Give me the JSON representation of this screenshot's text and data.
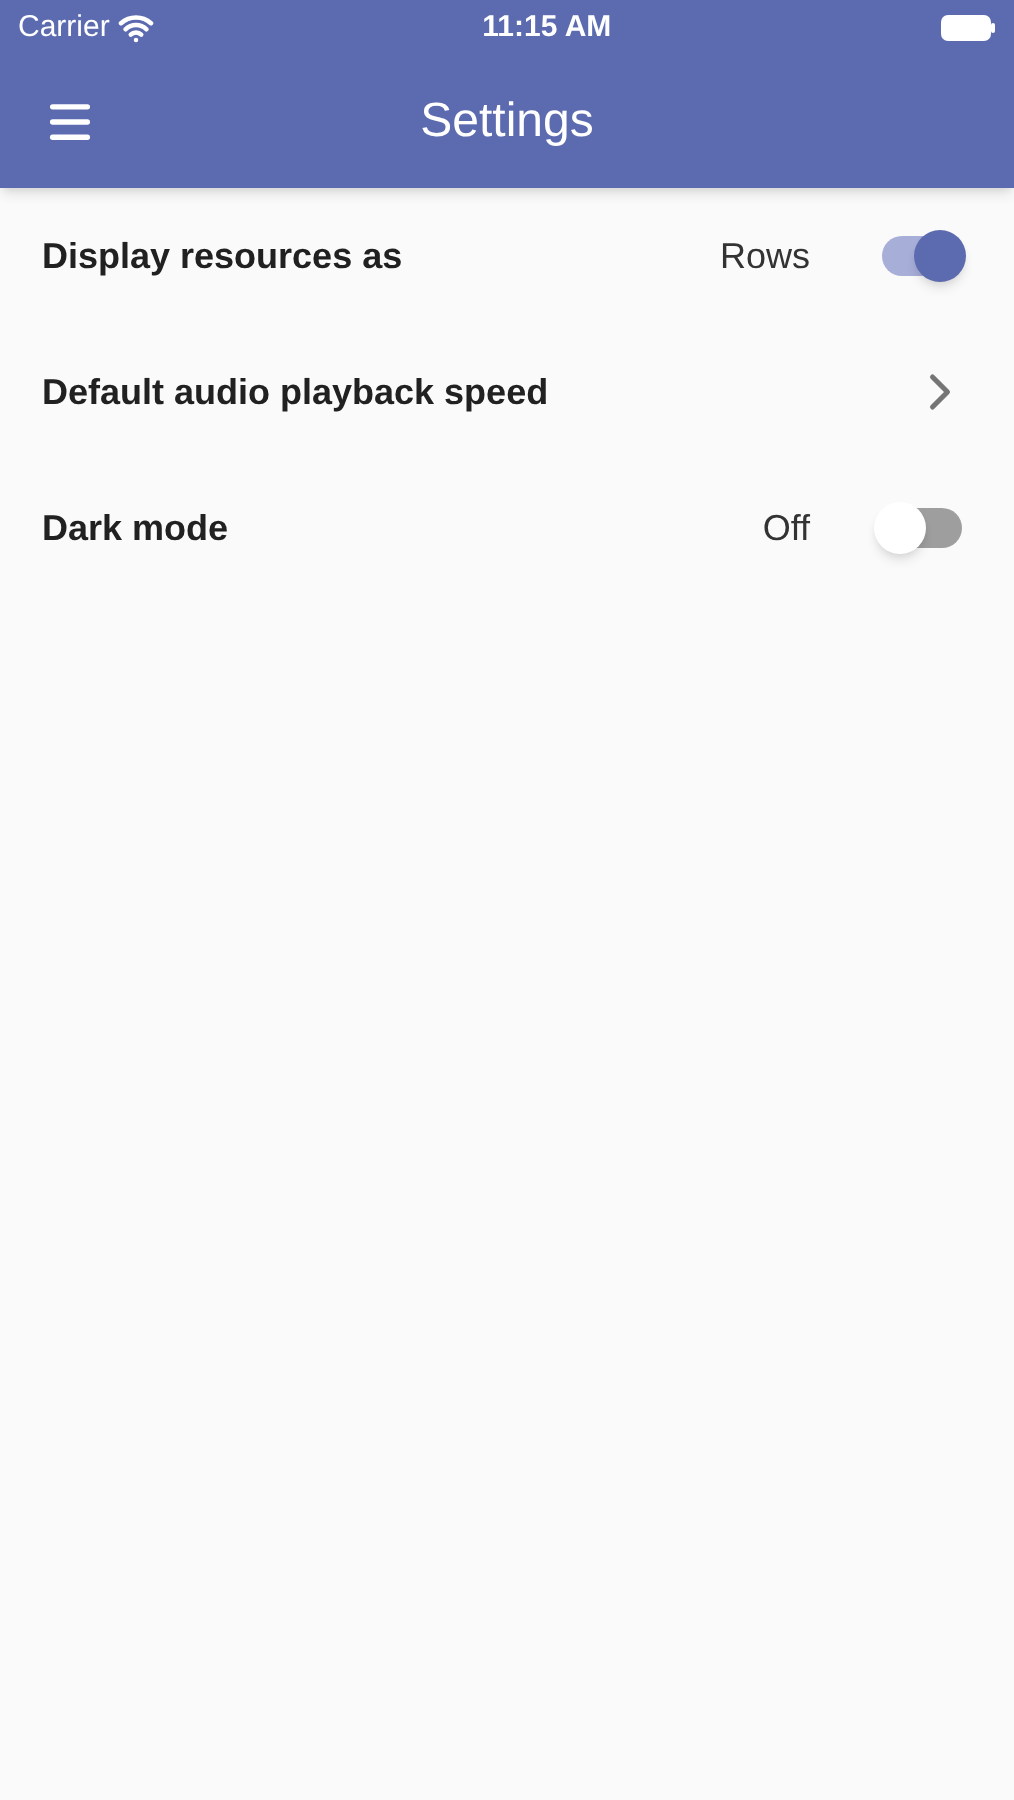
{
  "status_bar": {
    "carrier": "Carrier",
    "time": "11:15 AM"
  },
  "app_bar": {
    "title": "Settings"
  },
  "settings": [
    {
      "kind": "switch",
      "label": "Display resources as",
      "value": "Rows",
      "on": true
    },
    {
      "kind": "link",
      "label": "Default audio playback speed"
    },
    {
      "kind": "switch",
      "label": "Dark mode",
      "value": "Off",
      "on": false
    }
  ]
}
